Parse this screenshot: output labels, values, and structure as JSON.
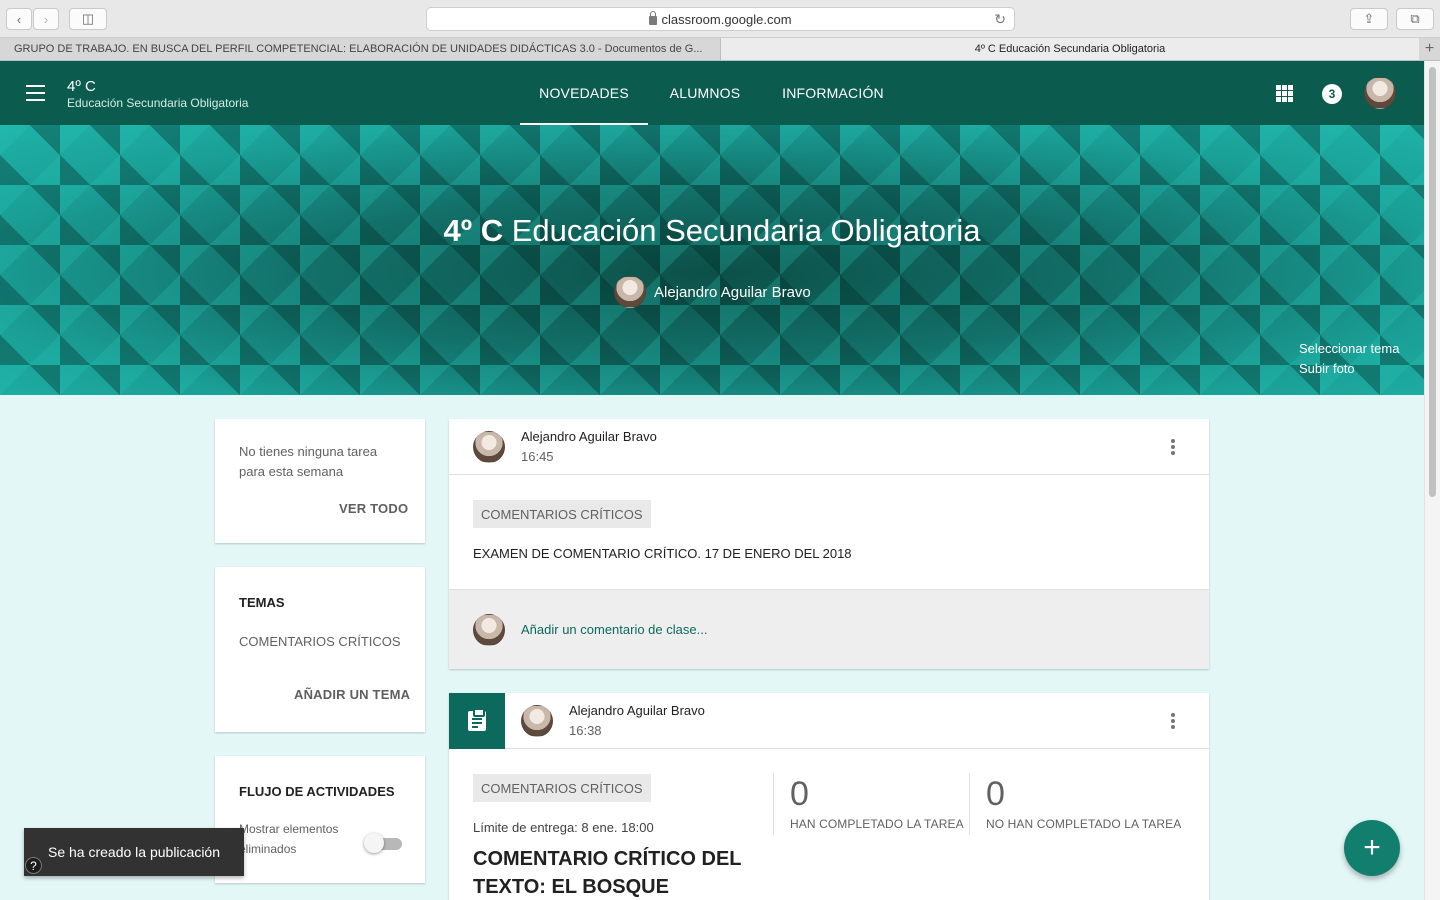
{
  "browser": {
    "url": "classroom.google.com",
    "tabs": [
      {
        "label": "GRUPO DE TRABAJO. EN BUSCA DEL PERFIL COMPETENCIAL: ELABORACIÓN DE UNIDADES DIDÁCTICAS 3.0 - Documentos de G..."
      },
      {
        "label": "4º C Educación Secundaria Obligatoria"
      }
    ]
  },
  "header": {
    "class_name": "4º C",
    "class_subtitle": "Educación Secundaria Obligatoria",
    "nav": [
      {
        "label": "NOVEDADES",
        "active": true
      },
      {
        "label": "ALUMNOS"
      },
      {
        "label": "INFORMACIÓN"
      }
    ],
    "notification_count": "3"
  },
  "banner": {
    "title_bold": "4º C",
    "title_rest": "Educación Secundaria Obligatoria",
    "teacher": "Alejandro Aguilar Bravo",
    "select_theme": "Seleccionar tema",
    "upload_photo": "Subir foto"
  },
  "sidebar": {
    "upcoming_line1": "No tienes ninguna tarea",
    "upcoming_line2": "para esta semana",
    "view_all": "VER TODO",
    "topics_heading": "TEMAS",
    "topic_1": "COMENTARIOS CRÍTICOS",
    "add_topic": "AÑADIR UN TEMA",
    "stream_heading": "FLUJO DE ACTIVIDADES",
    "show_deleted_line1": "Mostrar elementos",
    "show_deleted_line2": "eliminados"
  },
  "posts": [
    {
      "author": "Alejandro Aguilar Bravo",
      "time": "16:45",
      "topic": "COMENTARIOS CRÍTICOS",
      "body": "EXAMEN DE COMENTARIO CRÍTICO. 17 DE ENERO DEL 2018",
      "comment_placeholder": "Añadir un comentario de clase..."
    },
    {
      "author": "Alejandro Aguilar Bravo",
      "time": "16:38",
      "topic": "COMENTARIOS CRÍTICOS",
      "due": "Límite de entrega: 8 ene. 18:00",
      "title_line1": "COMENTARIO CRÍTICO DEL",
      "title_line2": "TEXTO: EL BOSQUE",
      "completed_count": "0",
      "completed_label": "HAN COMPLETADO LA TAREA",
      "not_completed_count": "0",
      "not_completed_label": "NO HAN COMPLETADO LA TAREA"
    }
  ],
  "toast": {
    "message": "Se ha creado la publicación",
    "help": "?"
  },
  "fab": {
    "icon": "+"
  },
  "colors": {
    "primary": "#0b5c4f",
    "background": "#e4f7f7",
    "accent": "#127f6e"
  }
}
